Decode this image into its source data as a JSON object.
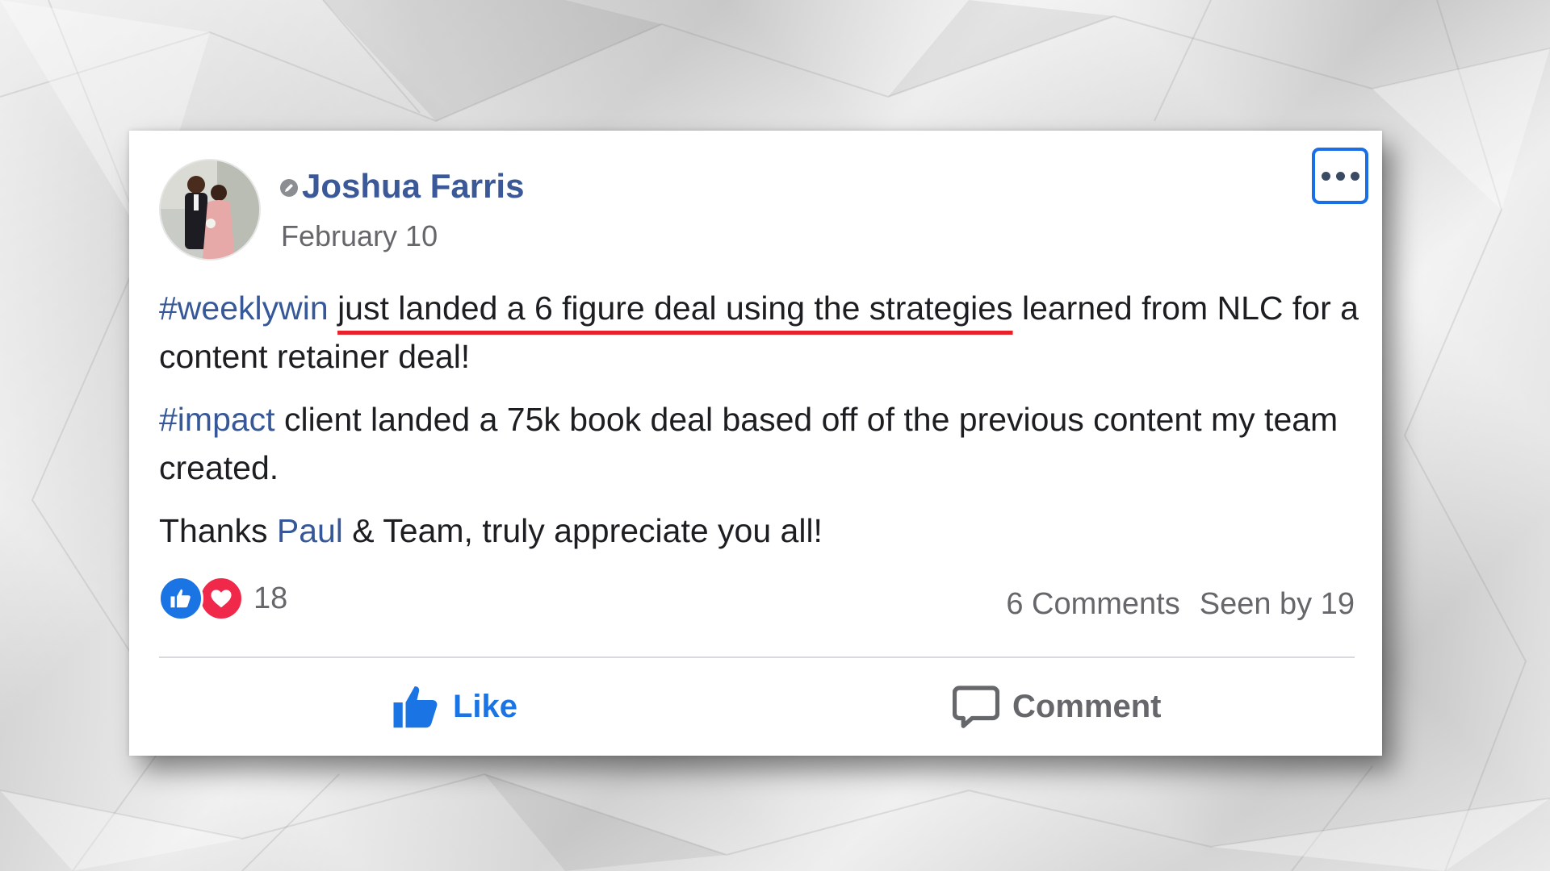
{
  "post": {
    "author": "Joshua Farris",
    "date": "February 10",
    "paragraph1": {
      "hashtag": "#weeklywin",
      "highlighted": "just landed a 6 figure deal using the strategies",
      "rest": " learned from NLC for a content retainer deal!"
    },
    "paragraph2": {
      "hashtag": "#impact",
      "rest": " client landed a 75k book deal based off of the previous content my team created."
    },
    "paragraph3": {
      "prefix": "Thanks ",
      "mention": "Paul",
      "suffix": " & Team, truly appreciate you all!"
    }
  },
  "stats": {
    "reaction_count": "18",
    "comments": "6 Comments",
    "seen_by": "Seen by 19"
  },
  "actions": {
    "like_label": "Like",
    "comment_label": "Comment"
  },
  "icons": {
    "edited": "edited-pencil-icon",
    "more": "more-options-icon",
    "like_reaction": "like-reaction-icon",
    "love_reaction": "love-reaction-icon",
    "like_action": "thumbs-up-icon",
    "comment_action": "comment-bubble-icon"
  },
  "colors": {
    "name_blue": "#3b5998",
    "link_blue": "#365899",
    "like_blue": "#1b74e4",
    "love_red": "#f0284a",
    "underline_red": "#e8202a",
    "more_button_border": "#1a6ee6"
  }
}
